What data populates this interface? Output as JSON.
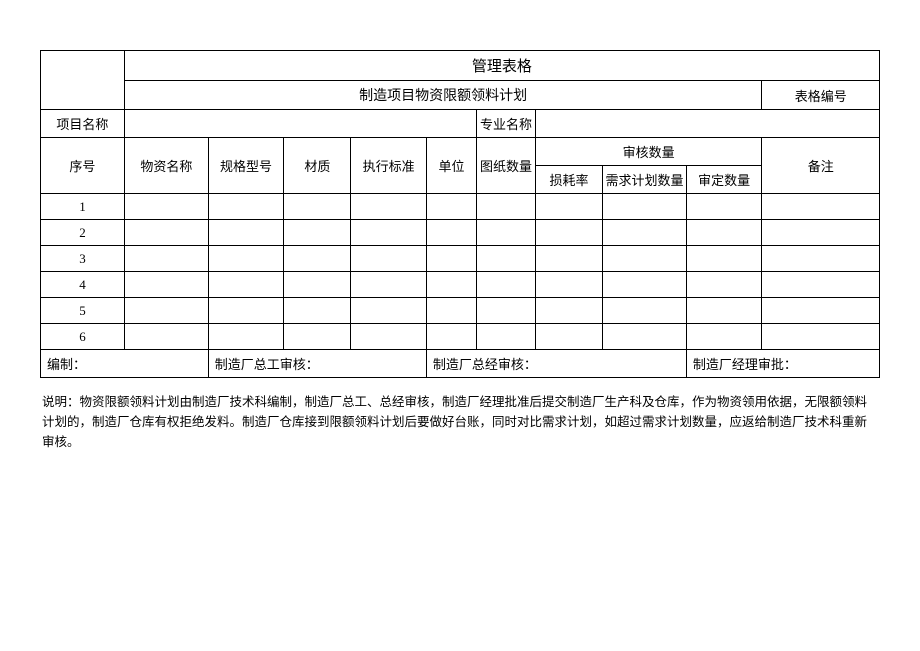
{
  "header": {
    "main_title": "管理表格",
    "sub_title": "制造项目物资限额领料计划",
    "form_number_label": "表格编号"
  },
  "info_row": {
    "project_name_label": "项目名称",
    "specialty_name_label": "专业名称"
  },
  "columns": {
    "seq": "序号",
    "material_name": "物资名称",
    "spec": "规格型号",
    "material": "材质",
    "standard": "执行标准",
    "unit": "单位",
    "drawing_qty": "图纸数量",
    "audit_qty_group": "审核数量",
    "loss_rate": "损耗率",
    "plan_qty": "需求计划数量",
    "approved_qty": "审定数量",
    "remark": "备注"
  },
  "rows": [
    "1",
    "2",
    "3",
    "4",
    "5",
    "6"
  ],
  "approval": {
    "compiled": "编制：",
    "chief_engineer": "制造厂总工审核：",
    "general_manager": "制造厂总经审核：",
    "manager_approve": "制造厂经理审批："
  },
  "note_label": "说明：",
  "note_text": "物资限额领料计划由制造厂技术科编制，制造厂总工、总经审核，制造厂经理批准后提交制造厂生产科及仓库，作为物资领用依据，无限额领料计划的，制造厂仓库有权拒绝发料。制造厂仓库接到限额领料计划后要做好台账，同时对比需求计划，如超过需求计划数量，应返给制造厂技术科重新审核。"
}
